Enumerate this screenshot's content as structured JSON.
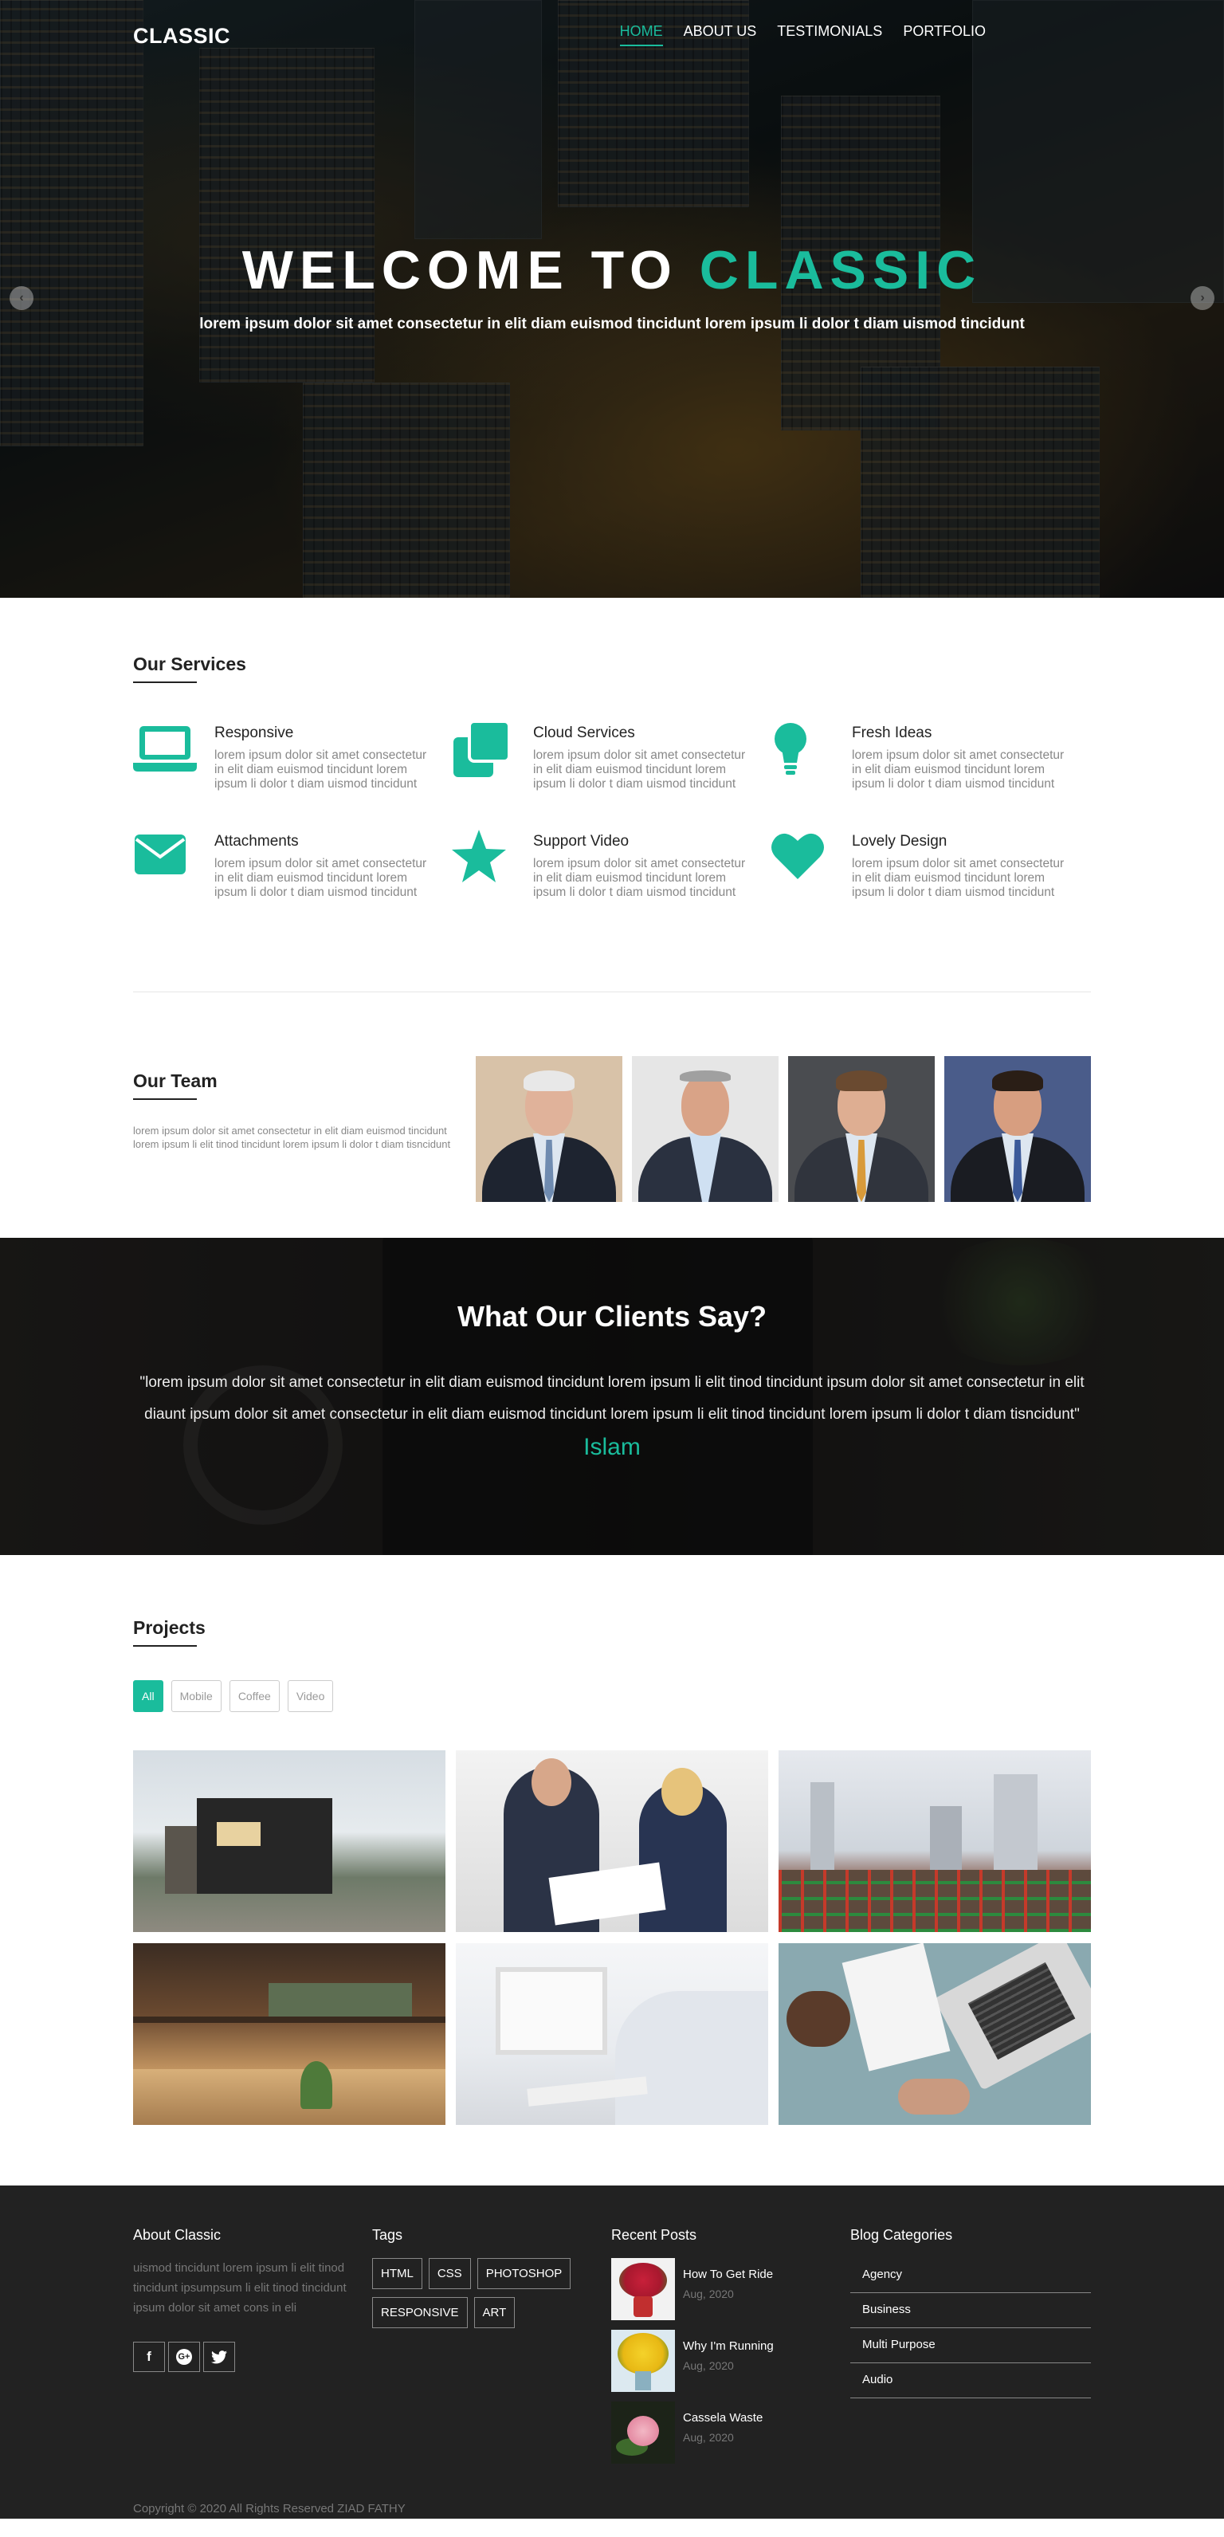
{
  "nav": {
    "logo": "CLASSIC",
    "items": [
      {
        "label": "HOME",
        "active": true
      },
      {
        "label": "ABOUT US",
        "active": false
      },
      {
        "label": "TESTIMONIALS",
        "active": false
      },
      {
        "label": "PORTFOLIO",
        "active": false
      }
    ]
  },
  "hero": {
    "title_prefix": "WELCOME TO",
    "title_accent": "CLASSIC",
    "subtitle": "lorem ipsum dolor sit amet consectetur in elit diam euismod tincidunt lorem ipsum li dolor t diam uismod tincidunt",
    "prev_icon": "chevron-left-icon",
    "next_icon": "chevron-right-icon"
  },
  "services": {
    "title": "Our Services",
    "items": [
      {
        "title": "Responsive",
        "icon": "laptop-icon",
        "text": "lorem ipsum dolor sit amet consectetur in elit diam euismod tincidunt lorem ipsum li dolor t diam uismod tincidunt"
      },
      {
        "title": "Cloud Services",
        "icon": "clone-icon",
        "text": "lorem ipsum dolor sit amet consectetur in elit diam euismod tincidunt lorem ipsum li dolor t diam uismod tincidunt"
      },
      {
        "title": "Fresh Ideas",
        "icon": "lightbulb-icon",
        "text": "lorem ipsum dolor sit amet consectetur in elit diam euismod tincidunt lorem ipsum li dolor t diam uismod tincidunt"
      },
      {
        "title": "Attachments",
        "icon": "envelope-icon",
        "text": "lorem ipsum dolor sit amet consectetur in elit diam euismod tincidunt lorem ipsum li dolor t diam uismod tincidunt"
      },
      {
        "title": "Support Video",
        "icon": "star-icon",
        "text": "lorem ipsum dolor sit amet consectetur in elit diam euismod tincidunt lorem ipsum li dolor t diam uismod tincidunt"
      },
      {
        "title": "Lovely Design",
        "icon": "heart-icon",
        "text": "lorem ipsum dolor sit amet consectetur in elit diam euismod tincidunt lorem ipsum li dolor t diam uismod tincidunt"
      }
    ]
  },
  "team": {
    "title": "Our Team",
    "text": "lorem ipsum dolor sit amet consectetur in elit diam euismod tincidunt lorem ipsum li elit tinod tincidunt lorem ipsum li dolor t diam tisncidunt"
  },
  "testimonial": {
    "title": "What Our Clients Say?",
    "quote": "\"lorem ipsum dolor sit amet consectetur in elit diam euismod tincidunt lorem ipsum li elit tinod tincidunt ipsum dolor sit amet consectetur in elit diaunt ipsum dolor sit amet consectetur in elit diam euismod tincidunt lorem ipsum li elit tinod tincidunt lorem ipsum li dolor t diam tisncidunt\"",
    "author": "Islam"
  },
  "projects": {
    "title": "Projects",
    "filters": [
      {
        "label": "All",
        "active": true
      },
      {
        "label": "Mobile",
        "active": false
      },
      {
        "label": "Coffee",
        "active": false
      },
      {
        "label": "Video",
        "active": false
      }
    ]
  },
  "footer": {
    "about": {
      "title": "About Classic",
      "text": "uismod tincidunt lorem ipsum li elit tinod tincidunt ipsumpsum li elit tinod tincidunt ipsum dolor sit amet cons in eli",
      "socials": [
        "facebook-icon",
        "google-plus-icon",
        "twitter-icon"
      ]
    },
    "tags": {
      "title": "Tags",
      "items": [
        "HTML",
        "CSS",
        "PHOTOSHOP",
        "RESPONSIVE",
        "ART"
      ]
    },
    "recent": {
      "title": "Recent Posts",
      "posts": [
        {
          "title": "How To Get Ride",
          "date": "Aug, 2020"
        },
        {
          "title": "Why I'm Running",
          "date": "Aug, 2020"
        },
        {
          "title": "Cassela Waste",
          "date": "Aug, 2020"
        }
      ]
    },
    "categories": {
      "title": "Blog Categories",
      "items": [
        "Agency",
        "Business",
        "Multi Purpose",
        "Audio"
      ]
    },
    "copyright": "Copyright © 2020 All Rights Reserved ZIAD FATHY"
  },
  "colors": {
    "accent": "#1abc9c",
    "footer_bg": "#222222"
  }
}
